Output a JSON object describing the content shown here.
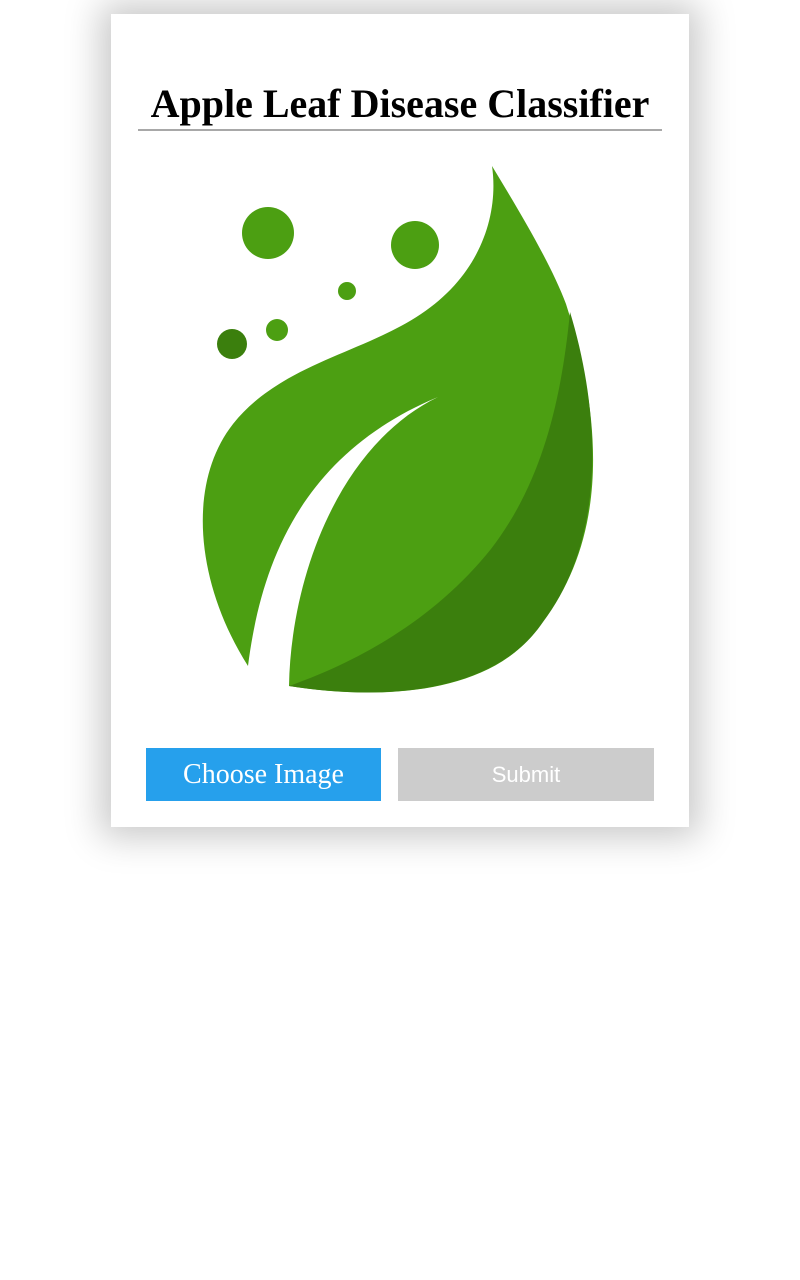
{
  "header": {
    "title": "Apple Leaf Disease Classifier"
  },
  "logo": {
    "icon": "leaf-icon",
    "colors": {
      "leaf_primary": "#4c9f12",
      "leaf_shade": "#3b7f0d"
    }
  },
  "actions": {
    "choose_label": "Choose Image",
    "submit_label": "Submit",
    "choose_color": "#26a0ec",
    "submit_color": "#cccccc"
  }
}
